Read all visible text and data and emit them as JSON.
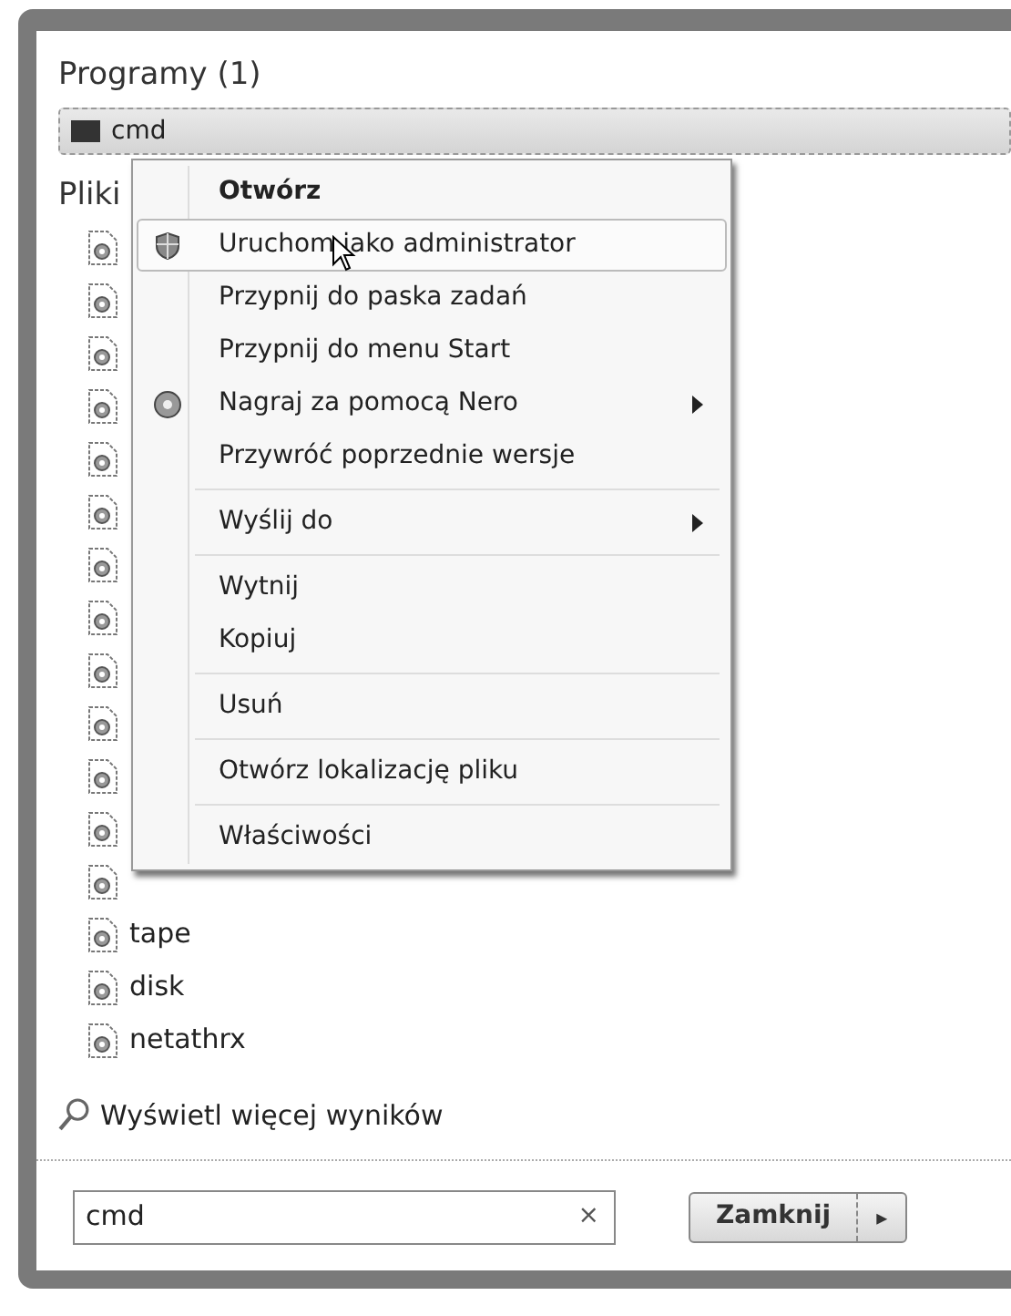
{
  "programs": {
    "heading": "Programy (1)",
    "items": [
      {
        "name": "cmd",
        "selected": true
      }
    ]
  },
  "files": {
    "heading": "Pliki",
    "items": [
      {
        "kind": "covered"
      },
      {
        "kind": "covered"
      },
      {
        "kind": "covered"
      },
      {
        "kind": "covered"
      },
      {
        "kind": "covered"
      },
      {
        "kind": "covered"
      },
      {
        "kind": "covered"
      },
      {
        "kind": "covered"
      },
      {
        "kind": "covered"
      },
      {
        "kind": "covered"
      },
      {
        "kind": "covered"
      },
      {
        "kind": "covered"
      },
      {
        "kind": "covered"
      },
      {
        "kind": "named",
        "name": "tape"
      },
      {
        "kind": "named",
        "name": "disk"
      },
      {
        "kind": "named",
        "name": "netathrx"
      }
    ]
  },
  "context_menu": {
    "items": [
      {
        "kind": "item",
        "label": "Otwórz",
        "default": true,
        "selected": false
      },
      {
        "kind": "shield",
        "label": "Uruchom jako administrator",
        "selected": true
      },
      {
        "kind": "item",
        "label": "Przypnij do paska zadań",
        "selected": false
      },
      {
        "kind": "item",
        "label": "Przypnij do menu Start",
        "selected": false
      },
      {
        "kind": "disc",
        "label": "Nagraj za pomocą Nero",
        "submenu": true,
        "selected": false
      },
      {
        "kind": "item",
        "label": "Przywróć poprzednie wersje",
        "selected": false
      },
      {
        "kind": "separator"
      },
      {
        "kind": "item",
        "label": "Wyślij do",
        "submenu": true,
        "selected": false
      },
      {
        "kind": "separator"
      },
      {
        "kind": "item",
        "label": "Wytnij",
        "selected": false
      },
      {
        "kind": "item",
        "label": "Kopiuj",
        "selected": false
      },
      {
        "kind": "separator"
      },
      {
        "kind": "item",
        "label": "Usuń",
        "selected": false
      },
      {
        "kind": "separator"
      },
      {
        "kind": "item",
        "label": "Otwórz lokalizację pliku",
        "selected": false
      },
      {
        "kind": "separator"
      },
      {
        "kind": "item",
        "label": "Właściwości",
        "selected": false
      }
    ]
  },
  "more_results": "Wyświetl więcej wyników",
  "search": {
    "value": "cmd",
    "clear": "×"
  },
  "shutdown": {
    "label": "Zamknij",
    "arrow": "▸"
  }
}
